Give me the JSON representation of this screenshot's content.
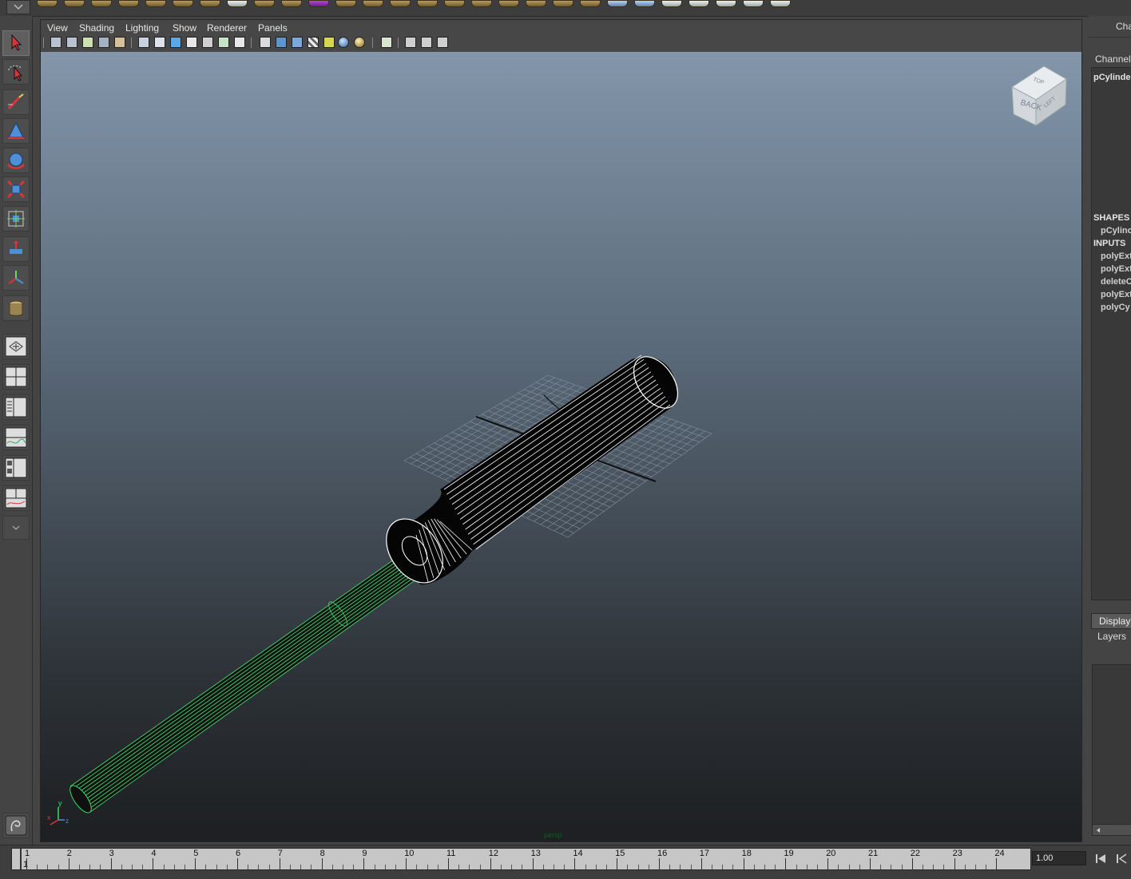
{
  "panel_menu": [
    "View",
    "Shading",
    "Lighting",
    "Show",
    "Renderer",
    "Panels"
  ],
  "viewport": {
    "camera_name": "persp",
    "view_cube": {
      "front": "BACK",
      "top": "TOP",
      "side": "LEFT"
    },
    "axis_labels": {
      "x": "x",
      "y": "y",
      "z": "z"
    }
  },
  "channel_box": {
    "title": "Cha",
    "header": "Channel",
    "object_name": "pCylinde",
    "shapes_label": "SHAPES",
    "shapes": [
      "pCylinc"
    ],
    "inputs_label": "INPUTS",
    "inputs": [
      "polyExt",
      "polyExt",
      "deleteC",
      "polyExt",
      "polyCy"
    ]
  },
  "layer_editor": {
    "tab_label": "Display",
    "layers_label": "Layers"
  },
  "timeline": {
    "frames": [
      "1",
      "2",
      "3",
      "4",
      "5",
      "6",
      "7",
      "8",
      "9",
      "10",
      "11",
      "12",
      "13",
      "14",
      "15",
      "16",
      "17",
      "18",
      "19",
      "20",
      "21",
      "22",
      "23",
      "24"
    ],
    "current_frame": "1",
    "current_time": "1.00"
  },
  "colors": {
    "selection_wireframe": "#3dd86a",
    "viewport_top": "#8396aa",
    "viewport_bottom": "#1d1f21"
  }
}
